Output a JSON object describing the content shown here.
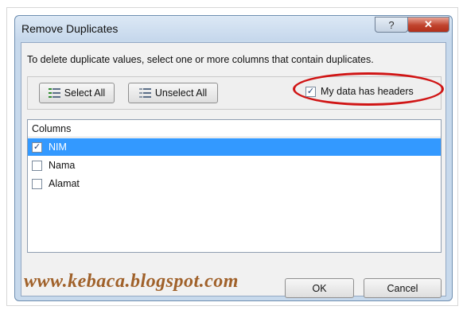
{
  "dialog": {
    "title": "Remove Duplicates",
    "help_label": "?",
    "close_label": "✕"
  },
  "instructions": "To delete duplicate values, select one or more columns that contain duplicates.",
  "buttons": {
    "select_all": "Select All",
    "unselect_all": "Unselect All",
    "ok": "OK",
    "cancel": "Cancel"
  },
  "headers_checkbox": {
    "label": "My data has headers",
    "checked": true,
    "check_glyph": "✓"
  },
  "columns": {
    "header": "Columns",
    "items": [
      {
        "label": "NIM",
        "checked": true,
        "check_glyph": "✓",
        "selected": true
      },
      {
        "label": "Nama",
        "checked": false,
        "check_glyph": "",
        "selected": false
      },
      {
        "label": "Alamat",
        "checked": false,
        "check_glyph": "",
        "selected": false
      }
    ]
  },
  "watermark": "www.kebaca.blogspot.com",
  "colors": {
    "highlight_ellipse": "#d01515",
    "selected_row": "#3399ff",
    "watermark": "#a0612a"
  }
}
